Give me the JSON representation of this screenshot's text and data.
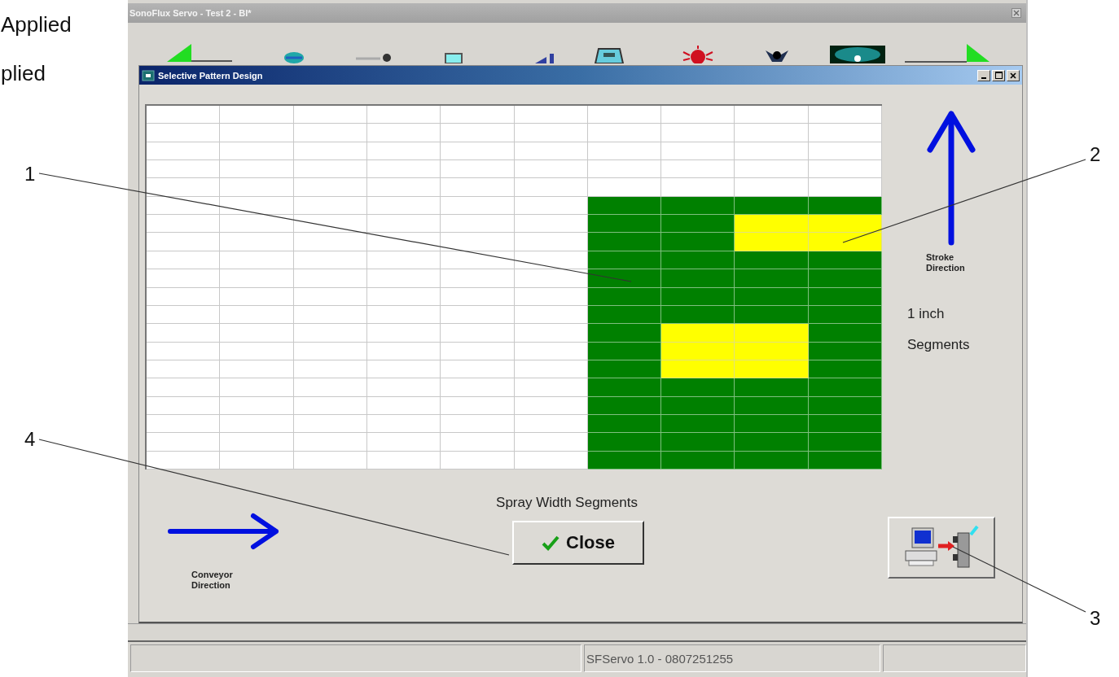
{
  "document_text": [
    "Applied",
    "plied"
  ],
  "app_window": {
    "title": "SonoFlux Servo - Test 2 - BI*"
  },
  "dialog": {
    "title": "Selective Pattern Design",
    "grid": {
      "rows": [
        [
          {
            "on": false,
            "selected": false
          },
          {
            "on": false,
            "selected": false
          },
          {
            "on": false,
            "selected": false
          },
          {
            "on": false,
            "selected": false
          },
          {
            "on": false,
            "selected": false
          },
          {
            "on": false,
            "selected": false
          },
          {
            "on": false,
            "selected": false
          },
          {
            "on": false,
            "selected": false
          },
          {
            "on": false,
            "selected": false
          },
          {
            "on": false,
            "selected": false
          }
        ],
        [
          {
            "on": false,
            "selected": false
          },
          {
            "on": false,
            "selected": false
          },
          {
            "on": false,
            "selected": false
          },
          {
            "on": false,
            "selected": false
          },
          {
            "on": false,
            "selected": false
          },
          {
            "on": false,
            "selected": false
          },
          {
            "on": false,
            "selected": false
          },
          {
            "on": false,
            "selected": false
          },
          {
            "on": false,
            "selected": false
          },
          {
            "on": false,
            "selected": false
          }
        ],
        [
          {
            "on": false,
            "selected": false
          },
          {
            "on": false,
            "selected": false
          },
          {
            "on": false,
            "selected": false
          },
          {
            "on": false,
            "selected": false
          },
          {
            "on": false,
            "selected": false
          },
          {
            "on": false,
            "selected": false
          },
          {
            "on": false,
            "selected": false
          },
          {
            "on": false,
            "selected": false
          },
          {
            "on": false,
            "selected": false
          },
          {
            "on": false,
            "selected": false
          }
        ],
        [
          {
            "on": false,
            "selected": false
          },
          {
            "on": false,
            "selected": false
          },
          {
            "on": false,
            "selected": false
          },
          {
            "on": false,
            "selected": false
          },
          {
            "on": false,
            "selected": false
          },
          {
            "on": false,
            "selected": false
          },
          {
            "on": false,
            "selected": false
          },
          {
            "on": false,
            "selected": false
          },
          {
            "on": false,
            "selected": false
          },
          {
            "on": false,
            "selected": false
          }
        ],
        [
          {
            "on": false,
            "selected": false
          },
          {
            "on": false,
            "selected": false
          },
          {
            "on": false,
            "selected": false
          },
          {
            "on": false,
            "selected": false
          },
          {
            "on": false,
            "selected": false
          },
          {
            "on": false,
            "selected": false
          },
          {
            "on": false,
            "selected": false
          },
          {
            "on": false,
            "selected": false
          },
          {
            "on": false,
            "selected": false
          },
          {
            "on": false,
            "selected": false
          }
        ],
        [
          {
            "on": false,
            "selected": false
          },
          {
            "on": false,
            "selected": false
          },
          {
            "on": false,
            "selected": false
          },
          {
            "on": false,
            "selected": false
          },
          {
            "on": false,
            "selected": false
          },
          {
            "on": false,
            "selected": false
          },
          {
            "on": true,
            "selected": false
          },
          {
            "on": true,
            "selected": false
          },
          {
            "on": true,
            "selected": false
          },
          {
            "on": true,
            "selected": false
          }
        ],
        [
          {
            "on": false,
            "selected": false
          },
          {
            "on": false,
            "selected": false
          },
          {
            "on": false,
            "selected": false
          },
          {
            "on": false,
            "selected": false
          },
          {
            "on": false,
            "selected": false
          },
          {
            "on": false,
            "selected": false
          },
          {
            "on": true,
            "selected": false
          },
          {
            "on": true,
            "selected": false
          },
          {
            "on": true,
            "selected": true
          },
          {
            "on": true,
            "selected": true
          }
        ],
        [
          {
            "on": false,
            "selected": false
          },
          {
            "on": false,
            "selected": false
          },
          {
            "on": false,
            "selected": false
          },
          {
            "on": false,
            "selected": false
          },
          {
            "on": false,
            "selected": false
          },
          {
            "on": false,
            "selected": false
          },
          {
            "on": true,
            "selected": false
          },
          {
            "on": true,
            "selected": false
          },
          {
            "on": true,
            "selected": true
          },
          {
            "on": true,
            "selected": true
          }
        ],
        [
          {
            "on": false,
            "selected": false
          },
          {
            "on": false,
            "selected": false
          },
          {
            "on": false,
            "selected": false
          },
          {
            "on": false,
            "selected": false
          },
          {
            "on": false,
            "selected": false
          },
          {
            "on": false,
            "selected": false
          },
          {
            "on": true,
            "selected": false
          },
          {
            "on": true,
            "selected": false
          },
          {
            "on": true,
            "selected": false
          },
          {
            "on": true,
            "selected": false
          }
        ],
        [
          {
            "on": false,
            "selected": false
          },
          {
            "on": false,
            "selected": false
          },
          {
            "on": false,
            "selected": false
          },
          {
            "on": false,
            "selected": false
          },
          {
            "on": false,
            "selected": false
          },
          {
            "on": false,
            "selected": false
          },
          {
            "on": true,
            "selected": false
          },
          {
            "on": true,
            "selected": false
          },
          {
            "on": true,
            "selected": false
          },
          {
            "on": true,
            "selected": false
          }
        ],
        [
          {
            "on": false,
            "selected": false
          },
          {
            "on": false,
            "selected": false
          },
          {
            "on": false,
            "selected": false
          },
          {
            "on": false,
            "selected": false
          },
          {
            "on": false,
            "selected": false
          },
          {
            "on": false,
            "selected": false
          },
          {
            "on": true,
            "selected": false
          },
          {
            "on": true,
            "selected": false
          },
          {
            "on": true,
            "selected": false
          },
          {
            "on": true,
            "selected": false
          }
        ],
        [
          {
            "on": false,
            "selected": false
          },
          {
            "on": false,
            "selected": false
          },
          {
            "on": false,
            "selected": false
          },
          {
            "on": false,
            "selected": false
          },
          {
            "on": false,
            "selected": false
          },
          {
            "on": false,
            "selected": false
          },
          {
            "on": true,
            "selected": false
          },
          {
            "on": true,
            "selected": false
          },
          {
            "on": true,
            "selected": false
          },
          {
            "on": true,
            "selected": false
          }
        ],
        [
          {
            "on": false,
            "selected": false
          },
          {
            "on": false,
            "selected": false
          },
          {
            "on": false,
            "selected": false
          },
          {
            "on": false,
            "selected": false
          },
          {
            "on": false,
            "selected": false
          },
          {
            "on": false,
            "selected": false
          },
          {
            "on": true,
            "selected": false
          },
          {
            "on": true,
            "selected": true
          },
          {
            "on": true,
            "selected": true
          },
          {
            "on": true,
            "selected": false
          }
        ],
        [
          {
            "on": false,
            "selected": false
          },
          {
            "on": false,
            "selected": false
          },
          {
            "on": false,
            "selected": false
          },
          {
            "on": false,
            "selected": false
          },
          {
            "on": false,
            "selected": false
          },
          {
            "on": false,
            "selected": false
          },
          {
            "on": true,
            "selected": false
          },
          {
            "on": true,
            "selected": true
          },
          {
            "on": true,
            "selected": true
          },
          {
            "on": true,
            "selected": false
          }
        ],
        [
          {
            "on": false,
            "selected": false
          },
          {
            "on": false,
            "selected": false
          },
          {
            "on": false,
            "selected": false
          },
          {
            "on": false,
            "selected": false
          },
          {
            "on": false,
            "selected": false
          },
          {
            "on": false,
            "selected": false
          },
          {
            "on": true,
            "selected": false
          },
          {
            "on": true,
            "selected": true
          },
          {
            "on": true,
            "selected": true
          },
          {
            "on": true,
            "selected": false
          }
        ],
        [
          {
            "on": false,
            "selected": false
          },
          {
            "on": false,
            "selected": false
          },
          {
            "on": false,
            "selected": false
          },
          {
            "on": false,
            "selected": false
          },
          {
            "on": false,
            "selected": false
          },
          {
            "on": false,
            "selected": false
          },
          {
            "on": true,
            "selected": false
          },
          {
            "on": true,
            "selected": false
          },
          {
            "on": true,
            "selected": false
          },
          {
            "on": true,
            "selected": false
          }
        ],
        [
          {
            "on": false,
            "selected": false
          },
          {
            "on": false,
            "selected": false
          },
          {
            "on": false,
            "selected": false
          },
          {
            "on": false,
            "selected": false
          },
          {
            "on": false,
            "selected": false
          },
          {
            "on": false,
            "selected": false
          },
          {
            "on": true,
            "selected": false
          },
          {
            "on": true,
            "selected": false
          },
          {
            "on": true,
            "selected": false
          },
          {
            "on": true,
            "selected": false
          }
        ],
        [
          {
            "on": false,
            "selected": false
          },
          {
            "on": false,
            "selected": false
          },
          {
            "on": false,
            "selected": false
          },
          {
            "on": false,
            "selected": false
          },
          {
            "on": false,
            "selected": false
          },
          {
            "on": false,
            "selected": false
          },
          {
            "on": true,
            "selected": false
          },
          {
            "on": true,
            "selected": false
          },
          {
            "on": true,
            "selected": false
          },
          {
            "on": true,
            "selected": false
          }
        ],
        [
          {
            "on": false,
            "selected": false
          },
          {
            "on": false,
            "selected": false
          },
          {
            "on": false,
            "selected": false
          },
          {
            "on": false,
            "selected": false
          },
          {
            "on": false,
            "selected": false
          },
          {
            "on": false,
            "selected": false
          },
          {
            "on": true,
            "selected": false
          },
          {
            "on": true,
            "selected": false
          },
          {
            "on": true,
            "selected": false
          },
          {
            "on": true,
            "selected": false
          }
        ],
        [
          {
            "on": false,
            "selected": false
          },
          {
            "on": false,
            "selected": false
          },
          {
            "on": false,
            "selected": false
          },
          {
            "on": false,
            "selected": false
          },
          {
            "on": false,
            "selected": false
          },
          {
            "on": false,
            "selected": false
          },
          {
            "on": true,
            "selected": false
          },
          {
            "on": true,
            "selected": false
          },
          {
            "on": true,
            "selected": false
          },
          {
            "on": true,
            "selected": false
          }
        ]
      ]
    },
    "stroke_label": "Stroke Direction",
    "segment_size": "1 inch",
    "segment_unit": "Segments",
    "width_label": "Spray Width Segments",
    "conveyor_label": "Conveyor Direction",
    "close_button": "Close"
  },
  "status_bar": {
    "version": "SFServo 1.0 - 0807251255"
  },
  "callouts": [
    "1",
    "2",
    "3",
    "4"
  ]
}
